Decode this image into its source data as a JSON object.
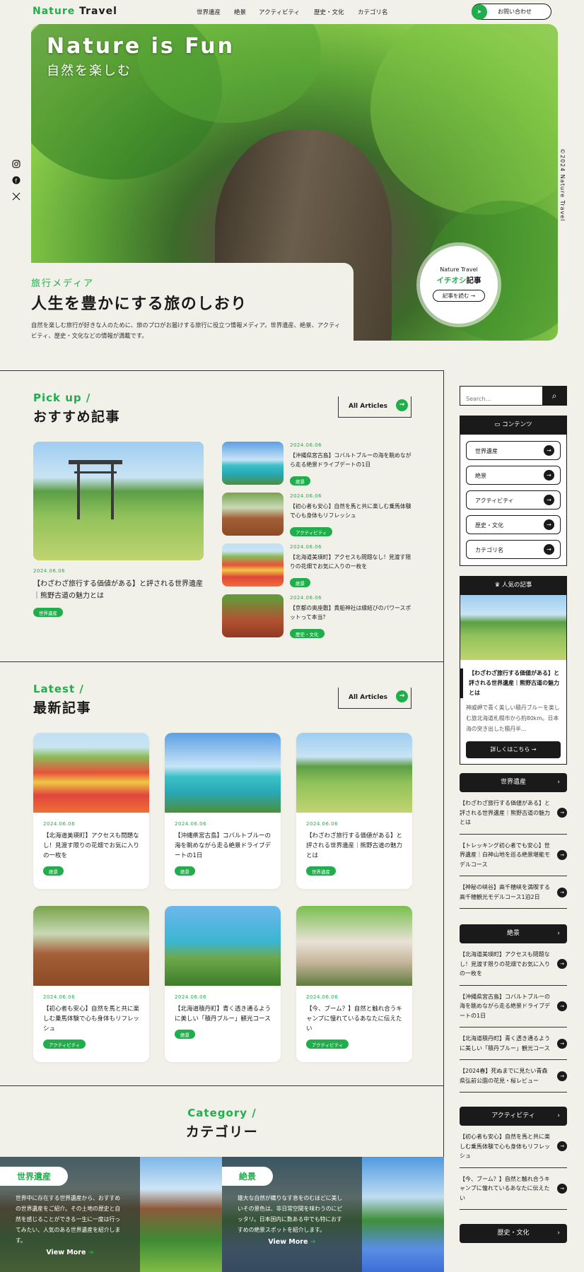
{
  "header": {
    "logo_1": "Nature",
    "logo_2": "Travel",
    "nav": [
      "世界遺産",
      "絶景",
      "アクティビティ",
      "歴史・文化",
      "カテゴリ名"
    ],
    "contact_label": "お問い合わせ"
  },
  "hero": {
    "title": "Nature is Fun",
    "subtitle": "自然を楽しむ",
    "label": "旅行メディア",
    "headline": "人生を豊かにする旅のしおり",
    "description": "自然を楽しむ旅行が好きな人のために、旅のプロがお届けする旅行に役立つ情報メディア。世界遺産、絶景、アクティビティ、歴史・文化などの情報が満載です。",
    "pickup_top": "Nature Travel",
    "pickup_green": "イチオシ",
    "pickup_rest": "記事",
    "pickup_button": "記事を読む",
    "copyright": "©2024 Nature Travel"
  },
  "pickup": {
    "en": "Pick up /",
    "ja": "おすすめ記事",
    "all": "All Articles",
    "main": {
      "date": "2024.06.06",
      "title": "【わざわざ旅行する価値がある】と評される世界遺産｜熊野古道の魅力とは",
      "tag": "世界遺産"
    },
    "items": [
      {
        "date": "2024.06.06",
        "title": "【沖縄県宮古島】コバルトブルーの海を眺めながら走る絶景ドライブデートの1日",
        "tag": "絶景"
      },
      {
        "date": "2024.06.06",
        "title": "【初心者も安心】自然を馬と共に楽しむ乗馬体験で心も身体もリフレッシュ",
        "tag": "アクティビティ"
      },
      {
        "date": "2024.06.06",
        "title": "【北海道美瑛町】アクセスも問題なし！見渡す限りの花畑でお気に入りの一枚を",
        "tag": "絶景"
      },
      {
        "date": "2024.06.06",
        "title": "【京都の奥座敷】貴船神社は縁結びのパワースポットって本当？",
        "tag": "歴史・文化"
      }
    ]
  },
  "latest": {
    "en": "Latest /",
    "ja": "最新記事",
    "all": "All Articles",
    "cards": [
      {
        "date": "2024.06.06",
        "title": "【北海道美瑛町】アクセスも問題なし！見渡す限りの花畑でお気に入りの一枚を",
        "tag": "絶景"
      },
      {
        "date": "2024.06.06",
        "title": "【沖縄県宮古島】コバルトブルーの海を眺めながら走る絶景ドライブデートの1日",
        "tag": "絶景"
      },
      {
        "date": "2024.06.06",
        "title": "【わざわざ旅行する価値がある】と評される世界遺産｜熊野古道の魅力とは",
        "tag": "世界遺産"
      },
      {
        "date": "2024.06.06",
        "title": "【初心者も安心】自然を馬と共に楽しむ乗馬体験で心も身体もリフレッシュ",
        "tag": "アクティビティ"
      },
      {
        "date": "2024.06.06",
        "title": "【北海道積丹町】青く透き通るように美しい「積丹ブルー」観光コース",
        "tag": "絶景"
      },
      {
        "date": "2024.06.06",
        "title": "【今、ブーム？】自然と触れ合うキャンプに憧れているあなたに伝えたい",
        "tag": "アクティビティ"
      }
    ]
  },
  "category": {
    "en": "Category /",
    "ja": "カテゴリー",
    "cards": [
      {
        "name": "世界遺産",
        "desc": "世界中に存在する世界遺産から、おすすめの世界遺産をご紹介。その土地の歴史と自然を感じることができる一生に一度は行ってみたい、人気のある世界遺産を紹介します。",
        "more": "View More"
      },
      {
        "name": "絶景",
        "desc": "雄大な自然が織りなす息をのむほどに美しいその景色は、非日常空間を味わうのにピッタリ。日本国内に数ある中でも特におすすめの絶景スポットを紹介します。",
        "more": "View More"
      }
    ]
  },
  "sidebar": {
    "search_placeholder": "Search...",
    "contents_title": "コンテンツ",
    "contents": [
      "世界遺産",
      "絶景",
      "アクティビティ",
      "歴史・文化",
      "カテゴリ名"
    ],
    "popular_title": "人気の記事",
    "popular_article": "【わざわざ旅行する価値がある】と評される世界遺産｜熊野古道の魅力とは",
    "popular_excerpt": "神威岬で青く美しい積丹ブルーを楽しむ旅北海道札幌市から約80km。日本海の突き出した積丹半...",
    "popular_button": "詳しくはこちら",
    "cat1": "世界遺産",
    "cat1_items": [
      "【わざわざ旅行する価値がある】と評される世界遺産｜熊野古道の魅力とは",
      "【トレッキング初心者でも安心】世界遺産｜白神山地を巡る絶景堪能モデルコース",
      "【神秘の峡谷】高千穂峡を満喫する高千穂観光モデルコース1泊2日"
    ],
    "cat2": "絶景",
    "cat2_items": [
      "【北海道美瑛町】アクセスも問題なし！見渡す限りの花畑でお気に入りの一枚を",
      "【沖縄県宮古島】コバルトブルーの海を眺めながら走る絶景ドライブデートの1日",
      "【北海道積丹町】青く透き通るように美しい「積丹ブルー」観光コース",
      "【2024春】死ぬまでに見たい青森県弘前公園の花見・桜レビュー"
    ],
    "cat3": "アクティビティ",
    "cat3_items": [
      "【初心者も安心】自然を馬と共に楽しむ乗馬体験で心も身体もリフレッシュ",
      "【今、ブーム？】自然と触れ合うキャンプに憧れているあなたに伝えたい"
    ],
    "cat4": "歴史・文化"
  },
  "colors": {
    "accent": "#1fae4b",
    "dark": "#1a1a1a",
    "background": "#f1f0e9"
  }
}
